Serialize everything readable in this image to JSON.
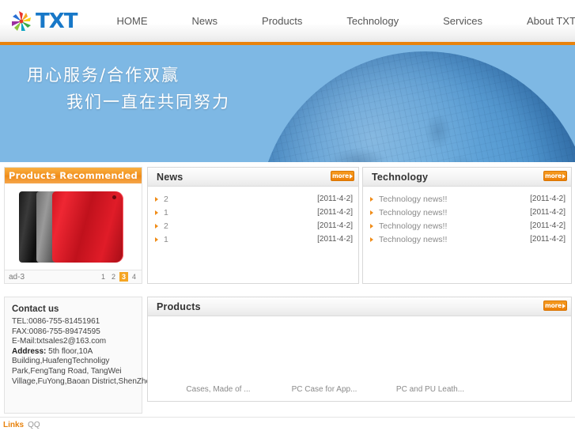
{
  "header": {
    "logo_text": "TXT",
    "logo_icon": "starburst-pinwheel-icon",
    "nav": [
      {
        "label": "HOME"
      },
      {
        "label": "News"
      },
      {
        "label": "Products"
      },
      {
        "label": "Technology"
      },
      {
        "label": "Services"
      },
      {
        "label": "About TXT"
      }
    ]
  },
  "banner": {
    "line1": "用心服务/合作双赢",
    "line2": "我们一直在共同努力",
    "image": "blue-globe-photo"
  },
  "products_recommended": {
    "title": "Products Recommended",
    "image_alt": "tablet-cases-black-gray-red",
    "caption": "ad-3",
    "pages": [
      "1",
      "2",
      "3",
      "4"
    ],
    "active_page": "3"
  },
  "news": {
    "title": "News",
    "more_label": "more",
    "items": [
      {
        "label": "2",
        "date": "[2011-4-2]"
      },
      {
        "label": "1",
        "date": "[2011-4-2]"
      },
      {
        "label": "2",
        "date": "[2011-4-2]"
      },
      {
        "label": "1",
        "date": "[2011-4-2]"
      }
    ]
  },
  "technology": {
    "title": "Technology",
    "more_label": "more",
    "items": [
      {
        "label": "Technology news!!",
        "date": "[2011-4-2]"
      },
      {
        "label": "Technology news!!",
        "date": "[2011-4-2]"
      },
      {
        "label": "Technology news!!",
        "date": "[2011-4-2]"
      },
      {
        "label": "Technology news!!",
        "date": "[2011-4-2]"
      }
    ]
  },
  "contact": {
    "title": "Contact us",
    "tel": "TEL:0086-755-81451961",
    "fax": "FAX:0086-755-89474595",
    "email": "E-Mail:txtsales2@163.com",
    "address_label": "Address:",
    "address_line1": " 5th floor,10A",
    "address_line2": "Building,HuafengTechnoligy",
    "address_line3": "Park,FengTang Road, TangWei",
    "address_line4": "Village,FuYong,Baoan District,ShenZhen"
  },
  "products": {
    "title": "Products",
    "more_label": "more",
    "items": [
      {
        "caption": "Cases, Made of ..."
      },
      {
        "caption": "PC Case for App..."
      },
      {
        "caption": "PC and PU Leath..."
      }
    ]
  },
  "footer": {
    "links_title": "Links",
    "links": [
      {
        "label": "QQ"
      }
    ]
  },
  "colors": {
    "accent_orange": "#e8820c",
    "banner_blue": "#7eb8e4",
    "logo_blue": "#1878c8"
  }
}
